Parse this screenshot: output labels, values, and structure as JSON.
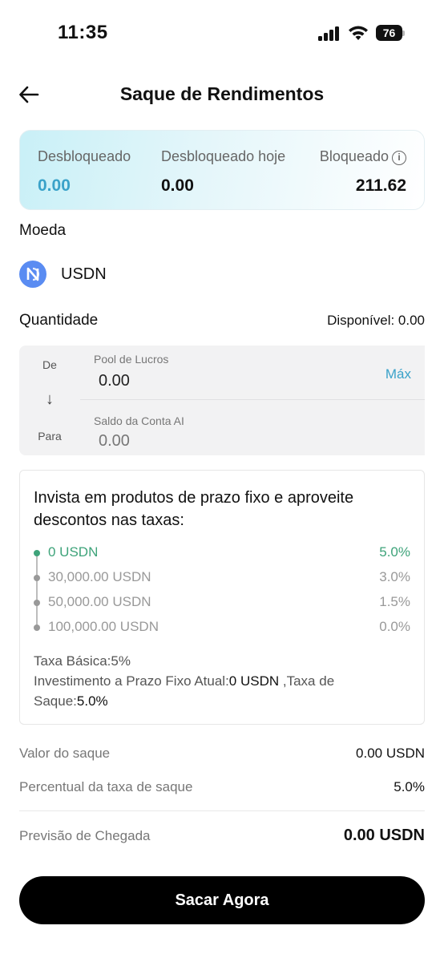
{
  "status_bar": {
    "time": "11:35",
    "battery": "76"
  },
  "header": {
    "title": "Saque de Rendimentos"
  },
  "balances": {
    "unlocked": {
      "label": "Desbloqueado",
      "value": "0.00"
    },
    "unlocked_today": {
      "label": "Desbloqueado hoje",
      "value": "0.00"
    },
    "locked": {
      "label": "Bloqueado",
      "value": "211.62",
      "info_icon": "i"
    }
  },
  "coin_section": {
    "label": "Moeda",
    "coin": "USDN"
  },
  "quantity_section": {
    "label": "Quantidade",
    "available": "Disponível: 0.00"
  },
  "transfer": {
    "from_label": "De",
    "to_label": "Para",
    "arrow": "↓",
    "from_account": "Pool de Lucros",
    "from_value": "0.00",
    "to_account": "Saldo da Conta AI",
    "to_value": "0.00",
    "max_label": "Máx"
  },
  "discount": {
    "title": "Invista em produtos de prazo fixo e aproveite descontos nas taxas:",
    "tiers": [
      {
        "amount": "0 USDN",
        "rate": "5.0%",
        "active": true
      },
      {
        "amount": "30,000.00 USDN",
        "rate": "3.0%",
        "active": false
      },
      {
        "amount": "50,000.00 USDN",
        "rate": "1.5%",
        "active": false
      },
      {
        "amount": "100,000.00 USDN",
        "rate": "0.0%",
        "active": false
      }
    ],
    "base_fee": "Taxa Básica:5%",
    "current_prefix": "Investimento a Prazo Fixo Atual:",
    "current_value": "0 USDN",
    "fee_prefix": " ,Taxa de Saque:",
    "fee_value": "5.0%"
  },
  "summary": {
    "withdraw_amount": {
      "label": "Valor do saque",
      "value": "0.00 USDN"
    },
    "fee_percent": {
      "label": "Percentual da taxa de saque",
      "value": "5.0%"
    },
    "arrival": {
      "label": "Previsão de Chegada",
      "value": "0.00 USDN"
    }
  },
  "cta": {
    "label": "Sacar Agora"
  },
  "colors": {
    "accent": "#3aa2c9",
    "active_tier": "#3ea37a",
    "coin": "#5a8cf2",
    "button": "#000000"
  }
}
